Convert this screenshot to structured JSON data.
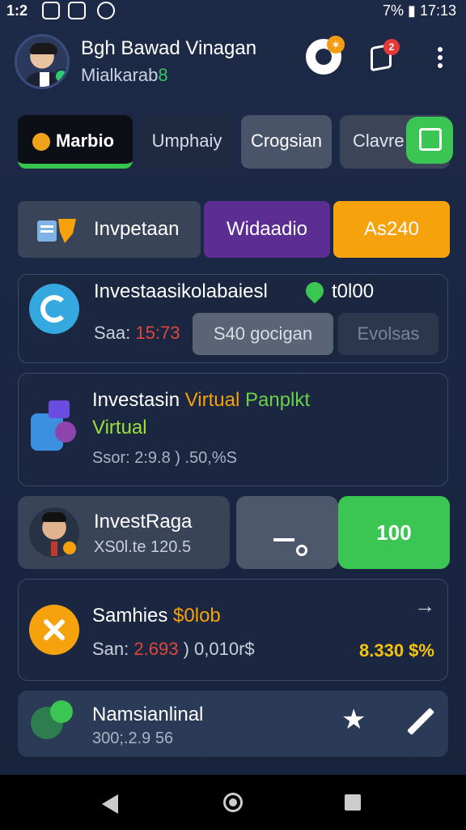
{
  "status_bar": {
    "time": "1:2",
    "right_text": "7% ▮ 17:13"
  },
  "header": {
    "user_name": "Bgh Bawad Vinagan",
    "user_handle_prefix": "Mialkarab",
    "user_handle_suffix": "8",
    "notification_count": "2"
  },
  "tabs": [
    {
      "label": "Marbio"
    },
    {
      "label": "Umphaiy"
    },
    {
      "label": "Crogsian"
    },
    {
      "label": "Clavre"
    }
  ],
  "categories": [
    {
      "label": "Invpetaan"
    },
    {
      "label": "Widaadio"
    },
    {
      "label": "As240"
    }
  ],
  "card1": {
    "title": "Investaasikolabaiesl",
    "amount": "t0l00",
    "sub_prefix": "Saa:",
    "sub_value": "15:73",
    "primary_button": "S40 gocigan",
    "secondary_button": "Evolsas"
  },
  "card2": {
    "title_start": "Investasin",
    "title_orange": "Virtual",
    "title_green": "Panplkt",
    "title_line2": "Virtual",
    "sub": "Ssor: 2:9.8 ) .50,%S"
  },
  "card3": {
    "name": "InvestRaga",
    "sub": "XS0l.te 120.5",
    "action_label": "100"
  },
  "card4": {
    "title_start": "Samhies",
    "title_orange": "$0lob",
    "sub_prefix": "San:",
    "sub_red": "2.693",
    "sub_rest": ") 0,010r$",
    "amount": "8.330 $%"
  },
  "card5": {
    "title": "Namsianlinal",
    "sub": "300;.2.9 56"
  },
  "colors": {
    "accent_green": "#3bc552",
    "accent_orange": "#f5a20c",
    "accent_purple": "#5c2e94",
    "background": "#1d2a47"
  }
}
